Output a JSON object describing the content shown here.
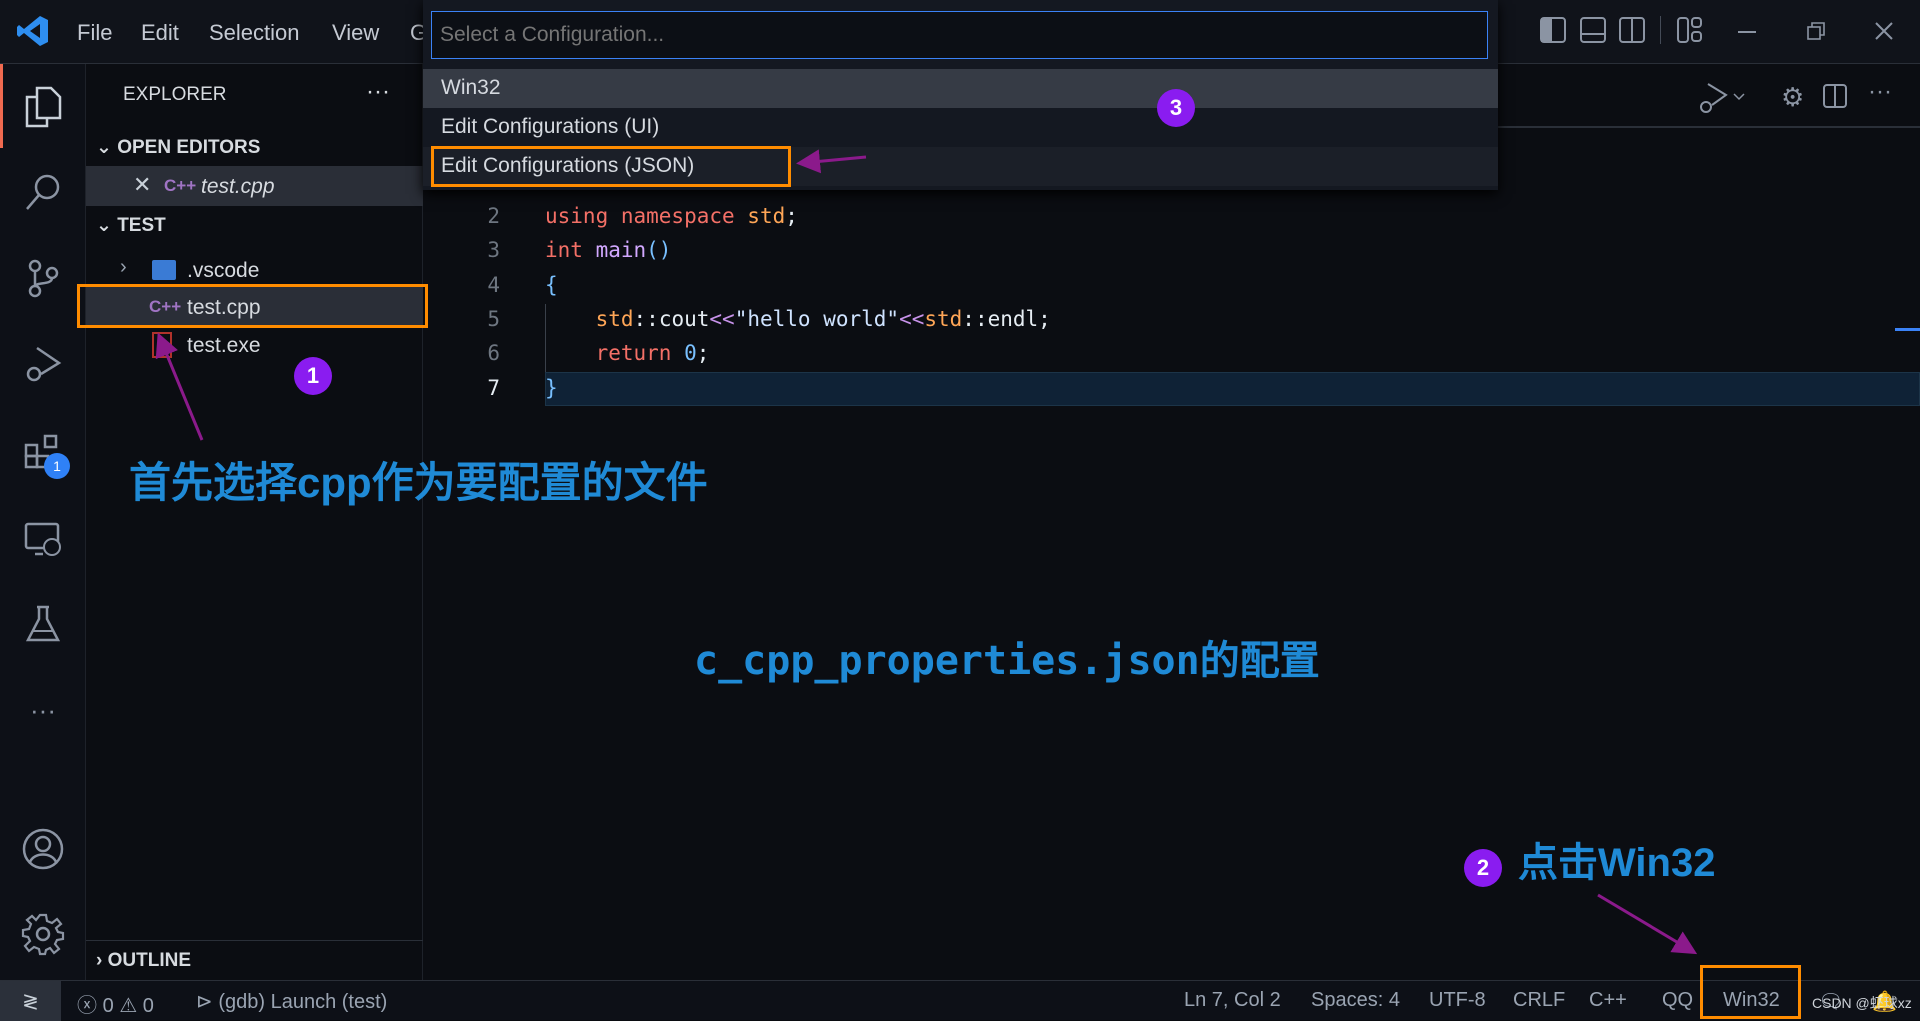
{
  "titlebar": {
    "menus": [
      "File",
      "Edit",
      "Selection",
      "View",
      "G"
    ]
  },
  "activity_bar": {
    "extensions_badge": "1"
  },
  "sidebar": {
    "title": "EXPLORER",
    "more": "···",
    "open_editors": {
      "label": "OPEN EDITORS",
      "items": [
        {
          "name": "test.cpp",
          "icon": "C++"
        }
      ]
    },
    "folder": {
      "label": "TEST",
      "items": [
        {
          "name": ".vscode"
        },
        {
          "name": "test.cpp",
          "icon": "C++"
        },
        {
          "name": "test.exe"
        }
      ]
    },
    "outline": "OUTLINE"
  },
  "quick_pick": {
    "placeholder": "Select a Configuration...",
    "items": [
      "Win32",
      "Edit Configurations (UI)",
      "Edit Configurations (JSON)"
    ]
  },
  "editor": {
    "lines": [
      {
        "n": "2",
        "tokens": [
          [
            "using ",
            "#f47067"
          ],
          [
            "namespace ",
            "#f47067"
          ],
          [
            "std",
            "#ffa657"
          ],
          [
            ";",
            "#e6edf3"
          ]
        ]
      },
      {
        "n": "3",
        "tokens": [
          [
            "int ",
            "#f47067"
          ],
          [
            "main",
            "#d2a8ff"
          ],
          [
            "()",
            "#79c0ff"
          ]
        ]
      },
      {
        "n": "4",
        "tokens": [
          [
            "{",
            "#79c0ff"
          ]
        ]
      },
      {
        "n": "5",
        "tokens": [
          [
            "    std",
            "#ffa657"
          ],
          [
            "::",
            "#e6edf3"
          ],
          [
            "cout",
            "#e6edf3"
          ],
          [
            "<<",
            "#c792ea"
          ],
          [
            "\"hello world\"",
            "#cfe3ff"
          ],
          [
            "<<",
            "#c792ea"
          ],
          [
            "std",
            "#ffa657"
          ],
          [
            "::",
            "#e6edf3"
          ],
          [
            "endl",
            "#e6edf3"
          ],
          [
            ";",
            "#e6edf3"
          ]
        ]
      },
      {
        "n": "6",
        "tokens": [
          [
            "    return ",
            "#f47067"
          ],
          [
            "0",
            "#79c0ff"
          ],
          [
            ";",
            "#e6edf3"
          ]
        ]
      },
      {
        "n": "7",
        "tokens": [
          [
            "}",
            "#79c0ff"
          ]
        ]
      }
    ]
  },
  "annotations": {
    "step1": "1",
    "step2": "2",
    "step3": "3",
    "text1": "首先选择cpp作为要配置的文件",
    "text_center": "c_cpp_properties.json的配置",
    "text2": "点击Win32",
    "highlight_color": "#ff8c00",
    "arrow_color": "#8b1a8b",
    "badge_color": "#8a1cf0"
  },
  "statusbar": {
    "errors": "0",
    "warnings": "0",
    "launch": "(gdb) Launch (test)",
    "position": "Ln 7, Col 2",
    "spaces": "Spaces: 4",
    "encoding": "UTF-8",
    "eol": "CRLF",
    "language": "C++",
    "qq": "QQ",
    "config": "Win32"
  },
  "watermark": "CSDN @虾球xz"
}
